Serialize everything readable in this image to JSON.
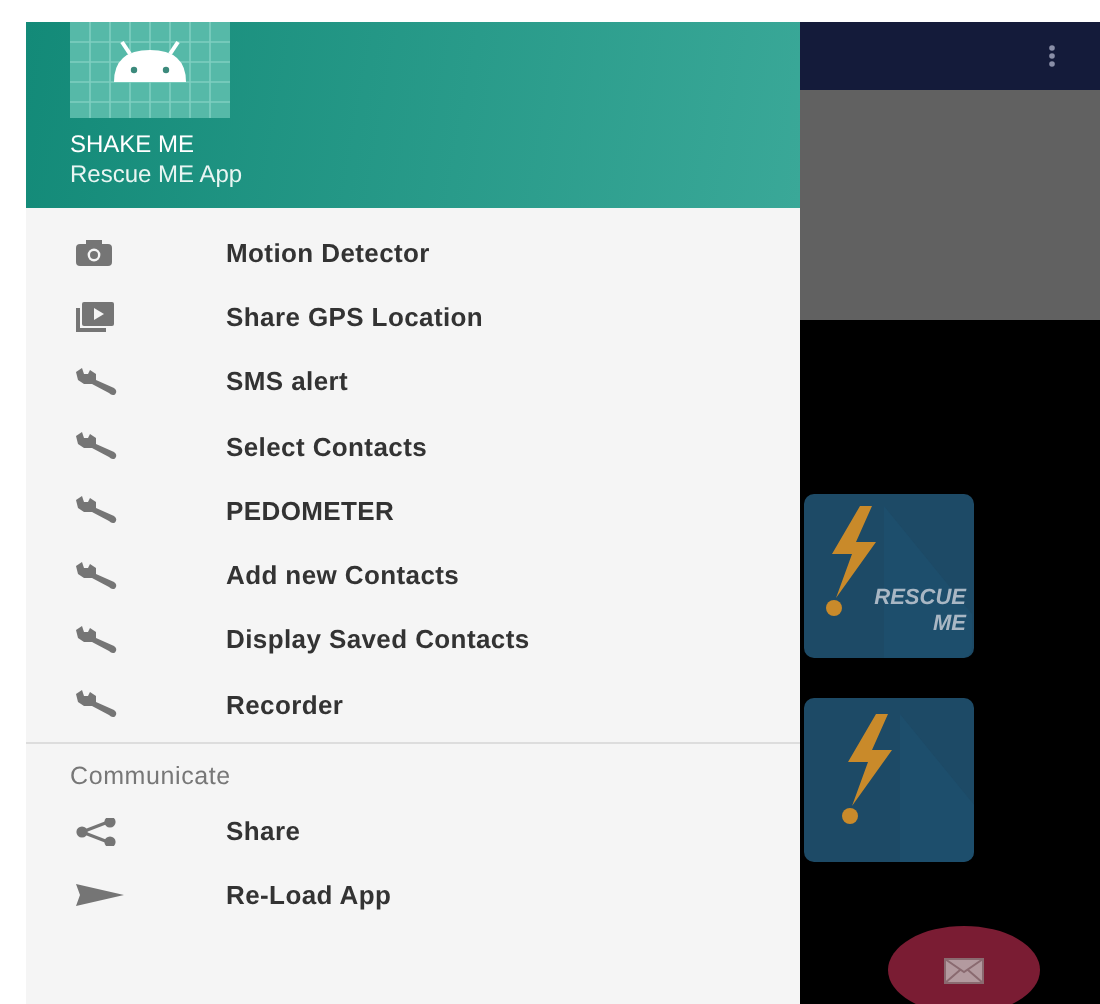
{
  "drawer": {
    "header": {
      "title": "SHAKE ME",
      "subtitle": "Rescue ME App"
    },
    "items": [
      {
        "kind": "camera",
        "label": "Motion Detector"
      },
      {
        "kind": "slideshow",
        "label": "Share GPS Location"
      },
      {
        "kind": "wrench",
        "label": "SMS alert"
      },
      {
        "kind": "wrench",
        "label": "Select Contacts"
      },
      {
        "kind": "wrench",
        "label": "PEDOMETER"
      },
      {
        "kind": "wrench",
        "label": "Add new Contacts"
      },
      {
        "kind": "wrench",
        "label": "Display Saved Contacts"
      },
      {
        "kind": "wrench",
        "label": "Recorder"
      }
    ],
    "section": {
      "title": "Communicate",
      "items": [
        {
          "kind": "share",
          "label": "Share"
        },
        {
          "kind": "send",
          "label": "Re-Load App"
        }
      ]
    }
  },
  "background": {
    "tiles": [
      {
        "kind": "logo-with-text",
        "text": [
          "RESCUE",
          "ME"
        ]
      },
      {
        "kind": "logo"
      }
    ]
  }
}
